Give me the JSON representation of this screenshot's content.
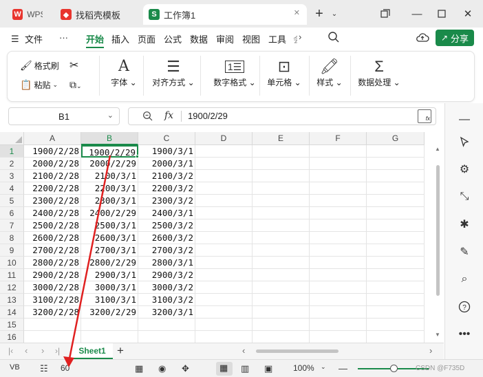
{
  "tabs": [
    {
      "label": "WPS",
      "icon_text": "W",
      "color": "#e8352e"
    },
    {
      "label": "找稻壳模板",
      "icon_text": "◆",
      "color": "#e8352e"
    },
    {
      "label": "工作簿1",
      "icon_text": "S",
      "color": "#1a8a4a"
    }
  ],
  "menu": {
    "file": "文件",
    "more": "···",
    "items": [
      "开始",
      "插入",
      "页面",
      "公式",
      "数据",
      "审阅",
      "视图",
      "工具",
      "会"
    ],
    "share": "分享"
  },
  "ribbon": {
    "format_painter": "格式刷",
    "paste": "粘贴",
    "font": "字体",
    "align": "对齐方式",
    "number_format": "数字格式",
    "cell": "单元格",
    "style": "样式",
    "data_process": "数据处理"
  },
  "formula_bar": {
    "name_box": "B1",
    "fx": "fx",
    "value": "1900/2/29"
  },
  "columns": [
    "A",
    "B",
    "C",
    "D",
    "E",
    "F",
    "G"
  ],
  "rows": [
    [
      "1900/2/28",
      "1900/2/29",
      "1900/3/1"
    ],
    [
      "2000/2/28",
      "2000/2/29",
      "2000/3/1"
    ],
    [
      "2100/2/28",
      "2100/3/1",
      "2100/3/2"
    ],
    [
      "2200/2/28",
      "2200/3/1",
      "2200/3/2"
    ],
    [
      "2300/2/28",
      "2300/3/1",
      "2300/3/2"
    ],
    [
      "2400/2/28",
      "2400/2/29",
      "2400/3/1"
    ],
    [
      "2500/2/28",
      "2500/3/1",
      "2500/3/2"
    ],
    [
      "2600/2/28",
      "2600/3/1",
      "2600/3/2"
    ],
    [
      "2700/2/28",
      "2700/3/1",
      "2700/3/2"
    ],
    [
      "2800/2/28",
      "2800/2/29",
      "2800/3/1"
    ],
    [
      "2900/2/28",
      "2900/3/1",
      "2900/3/2"
    ],
    [
      "3000/2/28",
      "3000/3/1",
      "3000/3/2"
    ],
    [
      "3100/2/28",
      "3100/3/1",
      "3100/3/2"
    ],
    [
      "3200/2/28",
      "3200/2/29",
      "3200/3/1"
    ],
    [
      "",
      "",
      ""
    ],
    [
      "",
      "",
      ""
    ]
  ],
  "sheet": {
    "name": "Sheet1",
    "add": "+"
  },
  "status": {
    "count": "60",
    "zoom": "100%",
    "watermark": "CSDN @F735D"
  },
  "colors": {
    "accent": "#1a8a4a",
    "annotation_arrow": "#e02020"
  }
}
